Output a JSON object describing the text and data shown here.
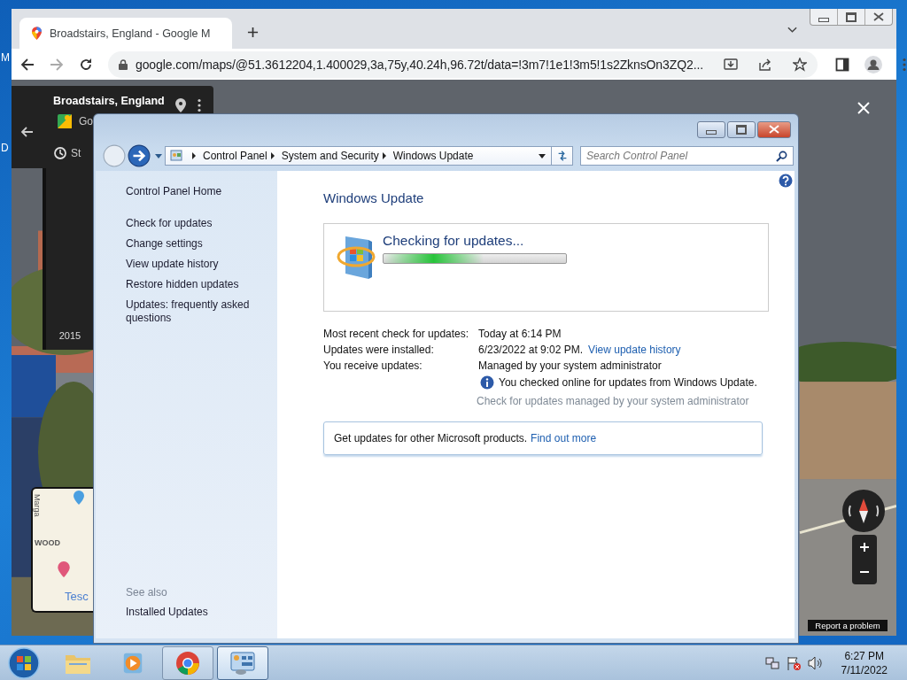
{
  "desktop": {
    "icon_labels": [
      "M",
      "D"
    ]
  },
  "browser": {
    "tab": {
      "title": "Broadstairs, England - Google M"
    },
    "url": "google.com/maps/@51.3612204,1.400029,3a,75y,40.24h,96.72t/data=!3m7!1e1!3m5!1s2ZknsOn3ZQ2..."
  },
  "street_view": {
    "place": "Broadstairs, England",
    "source": "Go",
    "timeline_label": "St",
    "year": "2015",
    "map_labels": [
      "Marga",
      "WOOD",
      "Tesc"
    ],
    "report": "Report a problem"
  },
  "control_panel": {
    "breadcrumb": [
      "Control Panel",
      "System and Security",
      "Windows Update"
    ],
    "search": {
      "placeholder": "Search Control Panel"
    },
    "sidebar": {
      "home": "Control Panel Home",
      "links": [
        "Check for updates",
        "Change settings",
        "View update history",
        "Restore hidden updates",
        "Updates: frequently asked questions"
      ],
      "see_also_heading": "See also",
      "see_also": [
        "Installed Updates"
      ]
    },
    "title": "Windows Update",
    "status": "Checking for updates...",
    "progress": {
      "level": 0.55
    },
    "details": [
      {
        "label": "Most recent check for updates:",
        "value": "Today at 6:14 PM"
      },
      {
        "label": "Updates were installed:",
        "value": "6/23/2022 at 9:02 PM.",
        "link": "View update history"
      },
      {
        "label": "You receive updates:",
        "value": "Managed by your system administrator"
      }
    ],
    "notice": "You checked online for updates from Windows Update.",
    "note": "Check for updates managed by your system administrator",
    "banner": {
      "text": "Get updates for other Microsoft products.",
      "link": "Find out more"
    }
  },
  "taskbar": {
    "apps": [
      {
        "kind": "explorer",
        "running": false,
        "selected": false
      },
      {
        "kind": "media",
        "running": false,
        "selected": false
      },
      {
        "kind": "chrome",
        "running": true,
        "selected": false
      },
      {
        "kind": "control-panel",
        "running": true,
        "selected": true
      }
    ],
    "time": "6:27 PM",
    "date": "7/11/2022"
  }
}
